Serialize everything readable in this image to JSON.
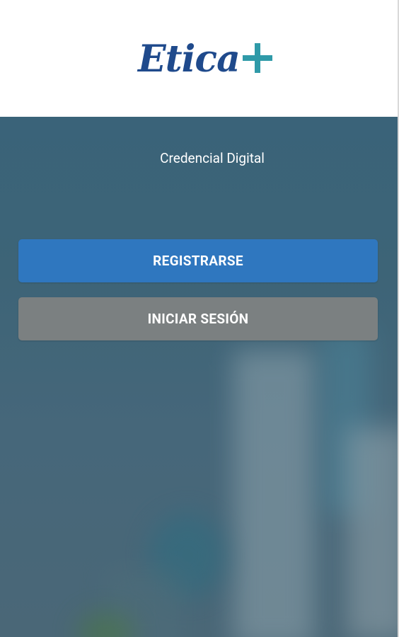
{
  "header": {
    "logo_text": "Etica",
    "logo_symbol": "+"
  },
  "hero": {
    "subtitle": "Credencial Digital"
  },
  "actions": {
    "register_label": "REGISTRARSE",
    "login_label": "INICIAR SESIÓN"
  },
  "colors": {
    "logo_text": "#1f4a8c",
    "logo_plus": "#2f9aa8",
    "register_button": "#2f77bf",
    "login_button": "#7b8081",
    "hero_overlay": "#3d6477"
  }
}
